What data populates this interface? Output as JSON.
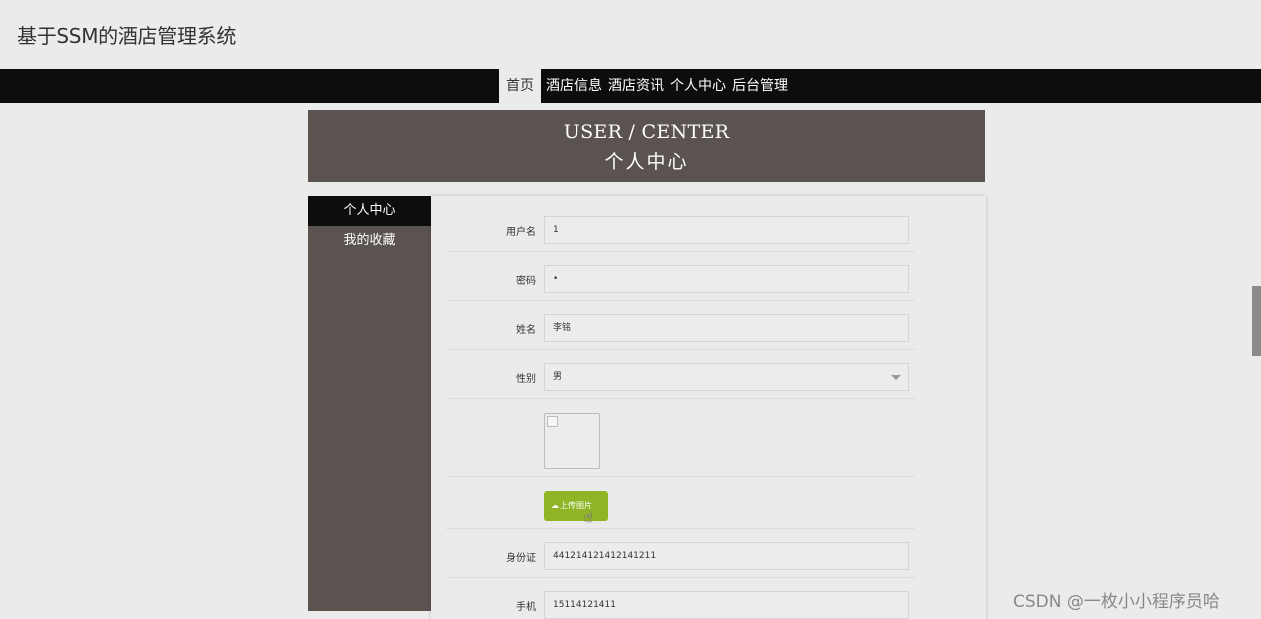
{
  "site": {
    "title": "基于SSM的酒店管理系统"
  },
  "nav": {
    "items": [
      {
        "label": "首页",
        "active": true
      },
      {
        "label": "酒店信息",
        "active": false
      },
      {
        "label": "酒店资讯",
        "active": false
      },
      {
        "label": "个人中心",
        "active": false
      },
      {
        "label": "后台管理",
        "active": false
      }
    ]
  },
  "banner": {
    "title_en": "USER / CENTER",
    "title_cn": "个人中心"
  },
  "sidebar": {
    "items": [
      {
        "label": "个人中心",
        "active": true
      },
      {
        "label": "我的收藏",
        "active": false
      }
    ]
  },
  "form": {
    "username": {
      "label": "用户名",
      "value": "1"
    },
    "password": {
      "label": "密码",
      "value": "•"
    },
    "name": {
      "label": "姓名",
      "value": "李铭"
    },
    "gender": {
      "label": "性别",
      "value": "男"
    },
    "upload": {
      "label": "上传图片",
      "icon": "cloud-upload-icon"
    },
    "id_card": {
      "label": "身份证",
      "value": "441214121412141211"
    },
    "phone": {
      "label": "手机",
      "value": "15114121411"
    }
  },
  "watermark": {
    "text": "CSDN @一枚小小程序员哈"
  },
  "colors": {
    "nav_bg": "#0d0d0d",
    "banner_bg": "#5a5350",
    "upload_btn": "#8fb526",
    "page_bg": "#ebebeb"
  }
}
